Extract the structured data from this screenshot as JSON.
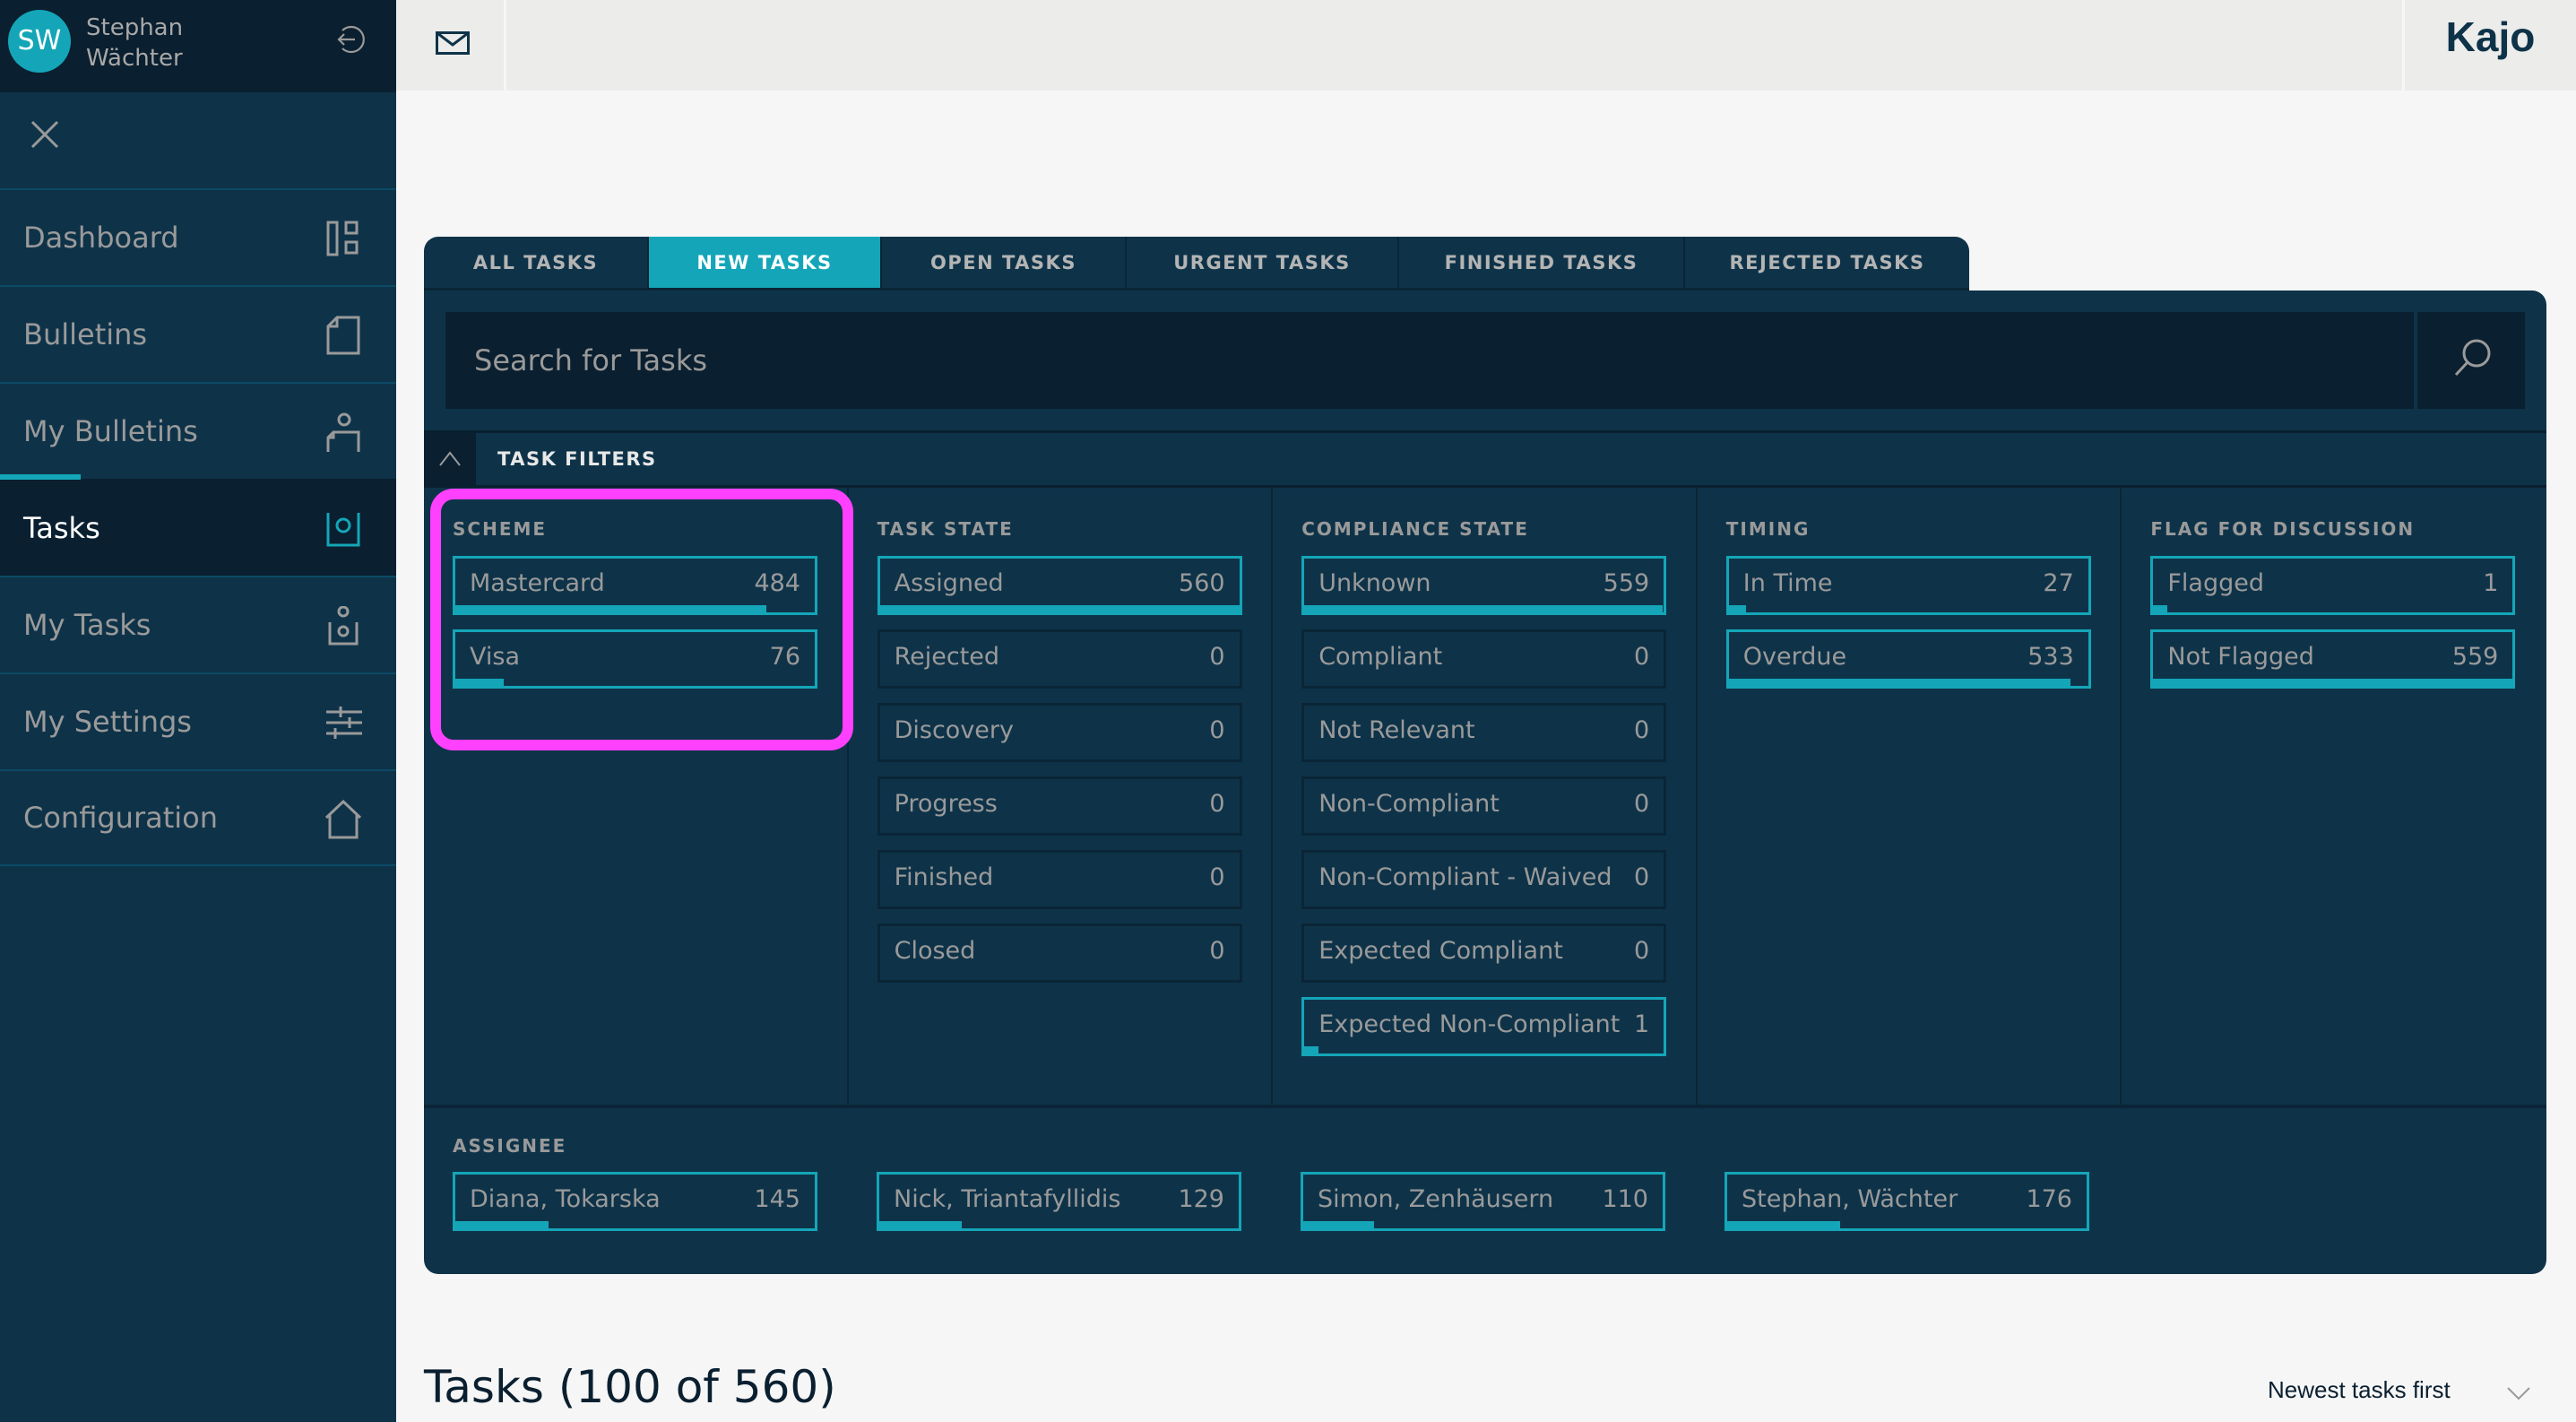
{
  "user": {
    "initials": "SW",
    "first_name": "Stephan",
    "last_name": "Wächter"
  },
  "brand": "Kajo",
  "sidebar": {
    "items": [
      {
        "label": "Dashboard",
        "icon": "dashboard-icon",
        "active": false
      },
      {
        "label": "Bulletins",
        "icon": "document-icon",
        "active": false
      },
      {
        "label": "My Bulletins",
        "icon": "user-document-icon",
        "active": false
      },
      {
        "label": "Tasks",
        "icon": "tasks-icon",
        "active": true
      },
      {
        "label": "My Tasks",
        "icon": "user-tasks-icon",
        "active": false
      },
      {
        "label": "My Settings",
        "icon": "sliders-icon",
        "active": false
      },
      {
        "label": "Configuration",
        "icon": "home-icon",
        "active": false
      }
    ]
  },
  "tabs": [
    {
      "label": "ALL TASKS",
      "active": false
    },
    {
      "label": "NEW TASKS",
      "active": true
    },
    {
      "label": "OPEN TASKS",
      "active": false
    },
    {
      "label": "URGENT TASKS",
      "active": false
    },
    {
      "label": "FINISHED TASKS",
      "active": false
    },
    {
      "label": "REJECTED TASKS",
      "active": false
    }
  ],
  "search": {
    "placeholder": "Search for Tasks",
    "value": ""
  },
  "filters": {
    "title": "TASK FILTERS",
    "total": 560,
    "columns": [
      {
        "title": "SCHEME",
        "items": [
          {
            "label": "Mastercard",
            "count": 484
          },
          {
            "label": "Visa",
            "count": 76
          }
        ]
      },
      {
        "title": "TASK STATE",
        "items": [
          {
            "label": "Assigned",
            "count": 560
          },
          {
            "label": "Rejected",
            "count": 0
          },
          {
            "label": "Discovery",
            "count": 0
          },
          {
            "label": "Progress",
            "count": 0
          },
          {
            "label": "Finished",
            "count": 0
          },
          {
            "label": "Closed",
            "count": 0
          }
        ]
      },
      {
        "title": "COMPLIANCE STATE",
        "items": [
          {
            "label": "Unknown",
            "count": 559
          },
          {
            "label": "Compliant",
            "count": 0
          },
          {
            "label": "Not Relevant",
            "count": 0
          },
          {
            "label": "Non-Compliant",
            "count": 0
          },
          {
            "label": "Non-Compliant - Waived",
            "count": 0
          },
          {
            "label": "Expected Compliant",
            "count": 0
          },
          {
            "label": "Expected Non-Compliant",
            "count": 1
          }
        ]
      },
      {
        "title": "TIMING",
        "items": [
          {
            "label": "In Time",
            "count": 27
          },
          {
            "label": "Overdue",
            "count": 533
          }
        ]
      },
      {
        "title": "FLAG FOR DISCUSSION",
        "items": [
          {
            "label": "Flagged",
            "count": 1
          },
          {
            "label": "Not Flagged",
            "count": 559
          }
        ]
      }
    ],
    "assignee": {
      "title": "ASSIGNEE",
      "items": [
        {
          "label": "Diana, Tokarska",
          "count": 145
        },
        {
          "label": "Nick, Triantafyllidis",
          "count": 129
        },
        {
          "label": "Simon, Zenhäusern",
          "count": 110
        },
        {
          "label": "Stephan, Wächter",
          "count": 176
        }
      ]
    }
  },
  "list": {
    "title": "Tasks (100 of 560)",
    "sort": "Newest tasks first"
  },
  "colors": {
    "accent": "#14a6b8",
    "sidebar": "#0e3349",
    "sidebar_dark": "#0a1f2f",
    "highlight": "#ff40ff"
  }
}
